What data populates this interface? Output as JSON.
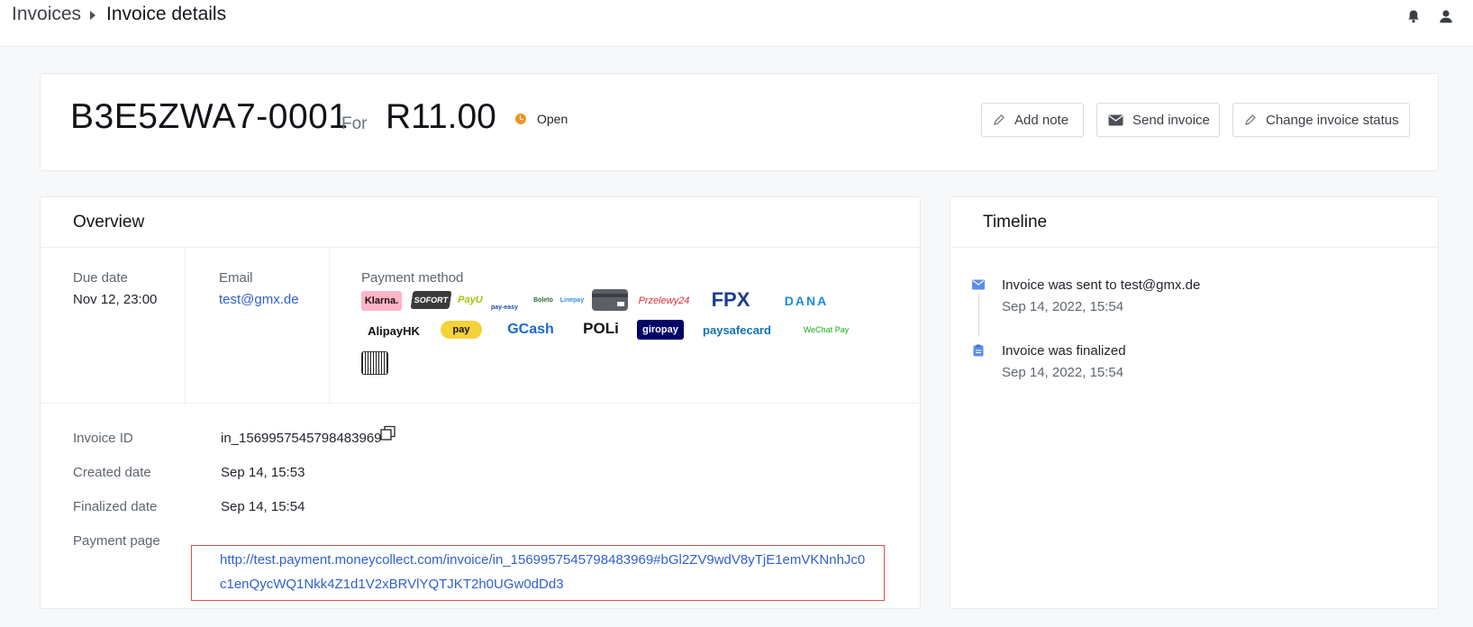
{
  "header": {
    "breadcrumb_root": "Invoices",
    "breadcrumb_current": "Invoice details"
  },
  "invoice": {
    "number": "B3E5ZWA7-0001",
    "for_label": "For",
    "amount": "R11.00",
    "status": "Open",
    "status_color": "#f29423"
  },
  "actions": {
    "add_note": "Add note",
    "send_invoice": "Send invoice",
    "change_status": "Change invoice status"
  },
  "overview": {
    "title": "Overview",
    "due_date_label": "Due date",
    "due_date": "Nov 12, 23:00",
    "email_label": "Email",
    "email": "test@gmx.de",
    "payment_method_label": "Payment method",
    "payment_methods": [
      "Klarna.",
      "SOFORT",
      "PayU",
      "pay-easy",
      "Boleto",
      "Linepay",
      "card",
      "Przelewy24",
      "FPX",
      "DANA",
      "AlipayHK",
      "pay",
      "GCash",
      "POLi",
      "giropay",
      "paysafecard",
      "WeChat Pay",
      "barcode"
    ],
    "invoice_id_label": "Invoice ID",
    "invoice_id": "in_1569957545798483969",
    "created_label": "Created date",
    "created": "Sep 14, 15:53",
    "finalized_label": "Finalized date",
    "finalized": "Sep 14, 15:54",
    "payment_page_label": "Payment page",
    "payment_page_url": "http://test.payment.moneycollect.com/invoice/in_1569957545798483969#bGl2ZV9wdV8yTjE1emVKNnhJc0c1enQycWQ1Nkk4Z1d1V2xBRVlYQTJKT2h0UGw0dDd3"
  },
  "timeline": {
    "title": "Timeline",
    "events": [
      {
        "text": "Invoice was sent to test@gmx.de",
        "time": "Sep 14, 2022, 15:54",
        "icon": "envelope-icon"
      },
      {
        "text": "Invoice was finalized",
        "time": "Sep 14, 2022, 15:54",
        "icon": "clipboard-icon"
      }
    ]
  },
  "colors": {
    "accent": "#2f5fd0",
    "highlight_border": "#e64a4a",
    "timeline_icon": "#5b8def"
  }
}
